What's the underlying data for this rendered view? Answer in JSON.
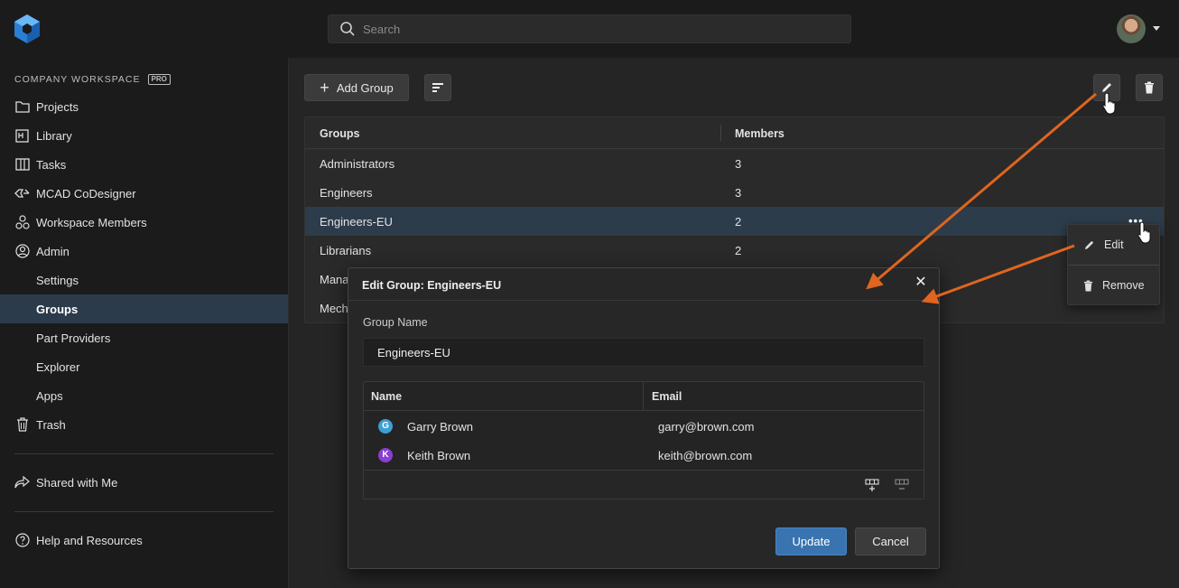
{
  "search": {
    "placeholder": "Search"
  },
  "sidebar": {
    "workspace_title": "COMPANY WORKSPACE",
    "workspace_badge": "PRO",
    "items": [
      {
        "label": "Projects",
        "icon": "folder-icon"
      },
      {
        "label": "Library",
        "icon": "library-icon"
      },
      {
        "label": "Tasks",
        "icon": "tasks-icon"
      },
      {
        "label": "MCAD CoDesigner",
        "icon": "codesigner-icon"
      },
      {
        "label": "Workspace Members",
        "icon": "members-icon"
      },
      {
        "label": "Admin",
        "icon": "admin-icon"
      },
      {
        "label": "Settings"
      },
      {
        "label": "Groups",
        "active": true
      },
      {
        "label": "Part Providers"
      },
      {
        "label": "Explorer"
      },
      {
        "label": "Apps"
      },
      {
        "label": "Trash",
        "icon": "trash-icon"
      },
      {
        "label": "Shared with Me",
        "icon": "share-icon"
      },
      {
        "label": "Help and Resources",
        "icon": "help-icon"
      }
    ]
  },
  "toolbar": {
    "add_group_label": "Add Group"
  },
  "groups_table": {
    "col_groups": "Groups",
    "col_members": "Members",
    "rows": [
      {
        "name": "Administrators",
        "members": "3"
      },
      {
        "name": "Engineers",
        "members": "3"
      },
      {
        "name": "Engineers-EU",
        "members": "2",
        "selected": true
      },
      {
        "name": "Librarians",
        "members": "2"
      },
      {
        "name": "Mana",
        "members": ""
      },
      {
        "name": "Mech",
        "members": ""
      }
    ],
    "more_label": "•••"
  },
  "context_menu": {
    "edit_label": "Edit",
    "remove_label": "Remove"
  },
  "dialog": {
    "title": "Edit Group: Engineers-EU",
    "close_glyph": "✕",
    "group_name_label": "Group Name",
    "group_name_value": "Engineers-EU",
    "members_table": {
      "col_name": "Name",
      "col_email": "Email",
      "rows": [
        {
          "initial": "G",
          "name": "Garry Brown",
          "email": "garry@brown.com",
          "color": "#3d9fd2"
        },
        {
          "initial": "K",
          "name": "Keith Brown",
          "email": "keith@brown.com",
          "color": "#8a3fd1"
        }
      ]
    },
    "update_label": "Update",
    "cancel_label": "Cancel"
  },
  "colors": {
    "accent": "#3a74b0",
    "arrow": "#e0651f",
    "selected_row": "#2d3c4b"
  }
}
